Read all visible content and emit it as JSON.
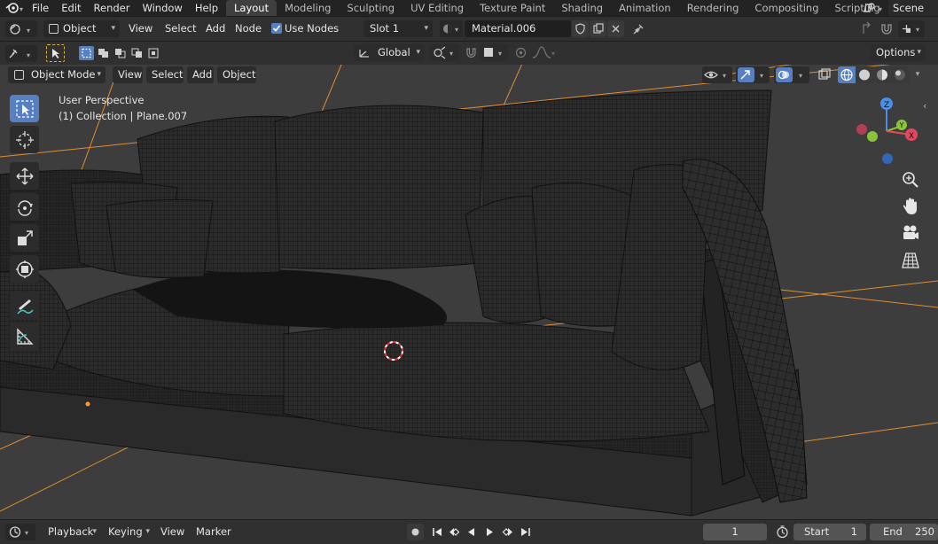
{
  "topbar": {
    "menus": [
      "File",
      "Edit",
      "Render",
      "Window",
      "Help"
    ],
    "workspaces": [
      "Layout",
      "Modeling",
      "Sculpting",
      "UV Editing",
      "Texture Paint",
      "Shading",
      "Animation",
      "Rendering",
      "Compositing",
      "Scripting"
    ],
    "active_workspace": "Layout",
    "add_workspace": "+",
    "scene_label": "Scene"
  },
  "node_header": {
    "object_type": "Object",
    "menus": [
      "View",
      "Select",
      "Add",
      "Node"
    ],
    "use_nodes_label": "Use Nodes",
    "use_nodes_checked": true,
    "slot": "Slot 1",
    "material": "Material.006"
  },
  "tool_header": {
    "orientation": "Global",
    "options_label": "Options"
  },
  "viewport_header": {
    "mode": "Object Mode",
    "menus": [
      "View",
      "Select",
      "Add",
      "Object"
    ]
  },
  "viewport": {
    "view_name": "User Perspective",
    "collection_info": "(1) Collection | Plane.007",
    "gizmo_axes": [
      "Z",
      "Y",
      "X"
    ]
  },
  "timeline": {
    "menus": [
      "Playback",
      "Keying",
      "View",
      "Marker"
    ],
    "current_frame": "1",
    "start_label": "Start",
    "start_value": "1",
    "end_label": "End",
    "end_value": "250"
  },
  "colors": {
    "accent": "#5680c2",
    "workspace_active": "#3f3f3f",
    "grid_orange": "#e38d2f",
    "axis_x": "#e2495f",
    "axis_y": "#8bc43a",
    "axis_z": "#4a8ee8"
  }
}
